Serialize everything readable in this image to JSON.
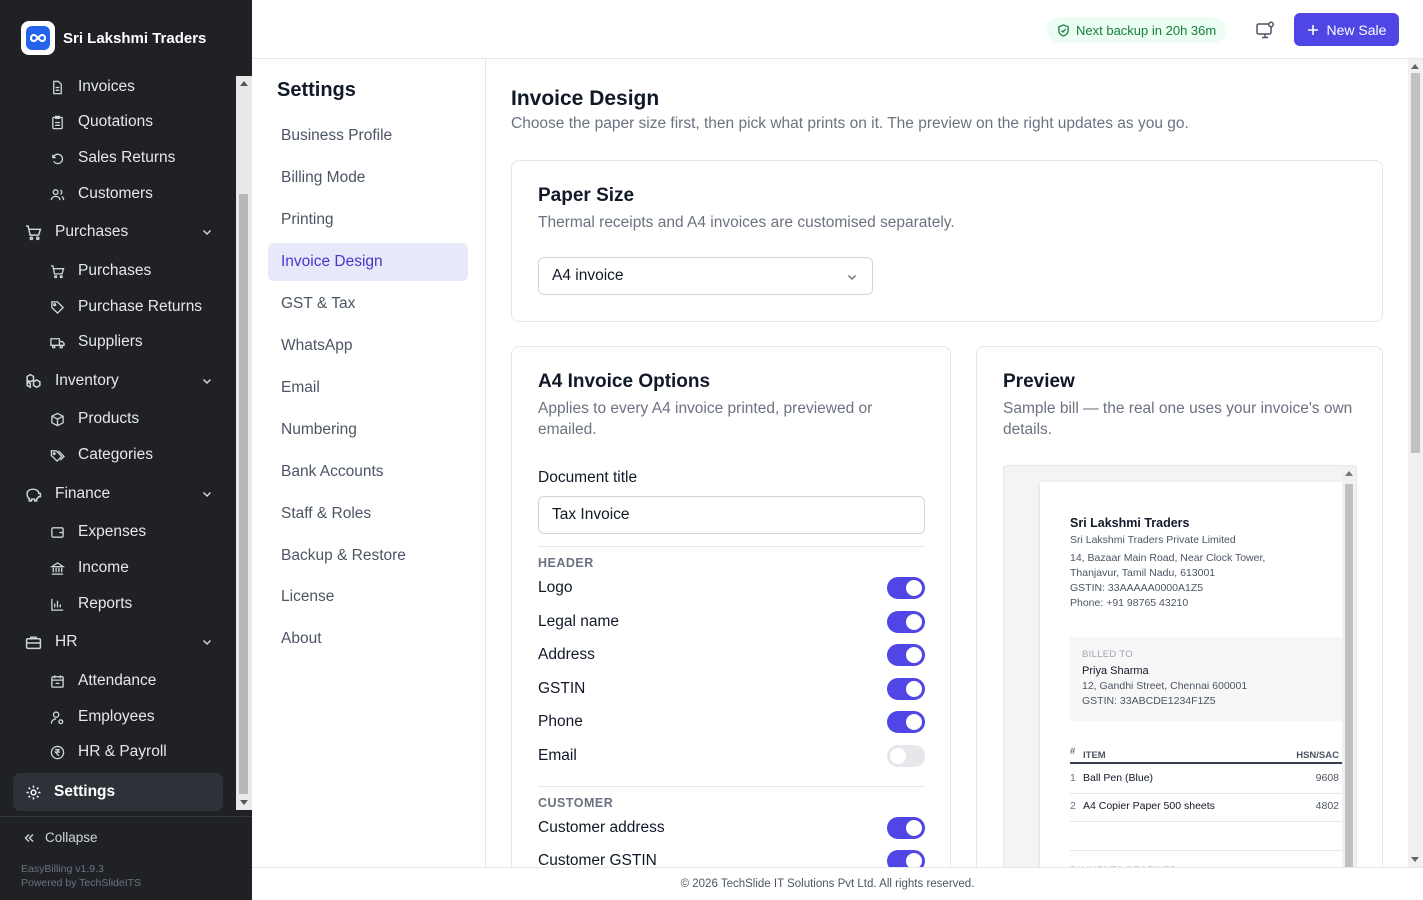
{
  "brand": {
    "name": "Sri Lakshmi Traders",
    "logo_icon": "infinity-logo-icon"
  },
  "sidebar": {
    "sub_items": [
      {
        "label": "Invoices",
        "icon": "file-icon"
      },
      {
        "label": "Quotations",
        "icon": "clipboard-icon"
      },
      {
        "label": "Sales Returns",
        "icon": "undo-icon"
      },
      {
        "label": "Customers",
        "icon": "users-icon"
      }
    ],
    "groups": [
      {
        "label": "Purchases",
        "icon": "cart-icon",
        "items": [
          "Purchases",
          "Purchase Returns",
          "Suppliers"
        ]
      },
      {
        "label": "Inventory",
        "icon": "boxes-icon",
        "items": [
          "Products",
          "Categories"
        ]
      },
      {
        "label": "Finance",
        "icon": "piggy-bank-icon",
        "items": [
          "Expenses",
          "Income",
          "Reports"
        ]
      },
      {
        "label": "HR",
        "icon": "briefcase-icon",
        "items": [
          "Attendance",
          "Employees",
          "HR & Payroll"
        ]
      }
    ],
    "settings_label": "Settings",
    "collapse_label": "Collapse",
    "version": "EasyBilling v1.9.3",
    "powered_by": "Powered by TechSlideITS"
  },
  "topbar": {
    "backup_text": "Next backup in 20h 36m",
    "new_sale_label": "New Sale"
  },
  "settings_nav": {
    "title": "Settings",
    "items": [
      "Business Profile",
      "Billing Mode",
      "Printing",
      "Invoice Design",
      "GST & Tax",
      "WhatsApp",
      "Email",
      "Numbering",
      "Bank Accounts",
      "Staff & Roles",
      "Backup & Restore",
      "License",
      "About"
    ],
    "active": "Invoice Design"
  },
  "page": {
    "title": "Invoice Design",
    "subtitle": "Choose the paper size first, then pick what prints on it. The preview on the right updates as you go."
  },
  "paper_size": {
    "title": "Paper Size",
    "subtitle": "Thermal receipts and A4 invoices are customised separately.",
    "selected": "A4 invoice"
  },
  "a4_options": {
    "title": "A4 Invoice Options",
    "subtitle_line1": "Applies to every A4 invoice printed, previewed or",
    "subtitle_line2": "emailed.",
    "doc_title_label": "Document title",
    "doc_title_value": "Tax Invoice",
    "header_section": "HEADER",
    "header_toggles": [
      {
        "label": "Logo",
        "on": true
      },
      {
        "label": "Legal name",
        "on": true
      },
      {
        "label": "Address",
        "on": true
      },
      {
        "label": "GSTIN",
        "on": true
      },
      {
        "label": "Phone",
        "on": true
      },
      {
        "label": "Email",
        "on": false
      }
    ],
    "customer_section": "CUSTOMER",
    "customer_toggles": [
      {
        "label": "Customer address",
        "on": true
      },
      {
        "label": "Customer GSTIN",
        "on": true
      }
    ]
  },
  "preview": {
    "title": "Preview",
    "subtitle_line1": "Sample bill — the real one uses your invoice's own",
    "subtitle_line2": "details.",
    "doc": {
      "business_name": "Sri Lakshmi Traders",
      "legal_name": "Sri Lakshmi Traders Private Limited",
      "address_line1": "14, Bazaar Main Road, Near Clock Tower,",
      "address_line2": "Thanjavur, Tamil Nadu, 613001",
      "gstin": "GSTIN: 33AAAAA0000A1Z5",
      "phone": "Phone: +91 98765 43210",
      "billed_to_label": "BILLED TO",
      "customer_name": "Priya Sharma",
      "customer_address": "12, Gandhi Street, Chennai 600001",
      "customer_gstin": "GSTIN: 33ABCDE1234F1Z5",
      "col_num": "#",
      "col_item": "ITEM",
      "col_hsn": "HSN/SAC",
      "rows": [
        {
          "num": "1",
          "item": "Ball Pen (Blue)",
          "hsn": "9608"
        },
        {
          "num": "2",
          "item": "A4 Copier Paper 500 sheets",
          "hsn": "4802"
        }
      ],
      "payments_label": "PAYMENTS RECEIVED"
    }
  },
  "footer": {
    "text": "© 2026 TechSlide IT Solutions Pvt Ltd. All rights reserved."
  },
  "colors": {
    "accent": "#4f46e5",
    "sidebar_bg": "#1f2125",
    "backup_green": "#15803d"
  }
}
